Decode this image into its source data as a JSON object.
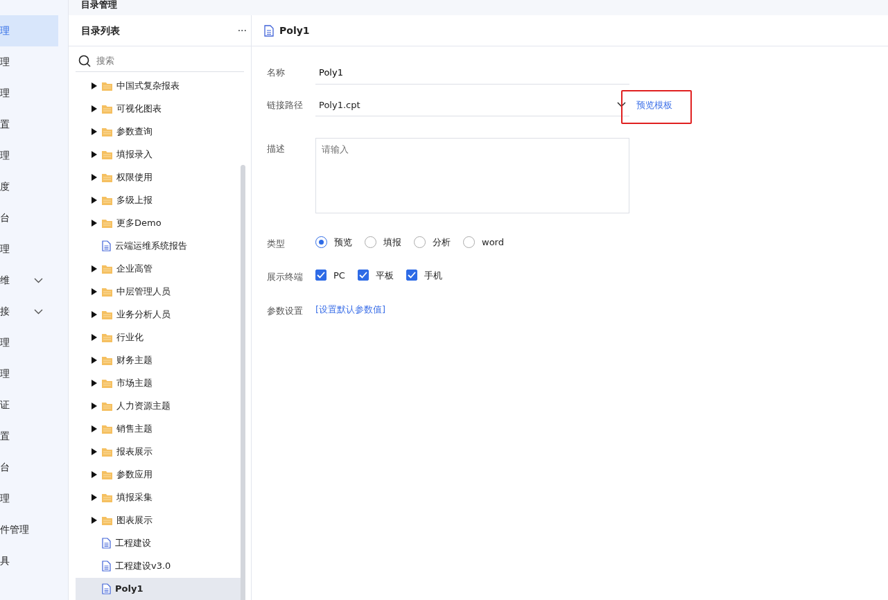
{
  "page_title": "目录管理",
  "sidebar": {
    "items": [
      {
        "label": "理",
        "selected": true
      },
      {
        "label": "理",
        "selected": false
      },
      {
        "label": "理",
        "selected": false
      },
      {
        "label": "置",
        "selected": false
      },
      {
        "label": "理",
        "selected": false
      },
      {
        "label": "度",
        "selected": false
      },
      {
        "label": "台",
        "selected": false
      },
      {
        "label": "理",
        "selected": false
      },
      {
        "label": "维",
        "selected": false,
        "expandable": true
      },
      {
        "label": "接",
        "selected": false,
        "expandable": true
      },
      {
        "label": "理",
        "selected": false
      },
      {
        "label": "理",
        "selected": false
      },
      {
        "label": "证",
        "selected": false
      },
      {
        "label": "置",
        "selected": false
      },
      {
        "label": "台",
        "selected": false
      },
      {
        "label": "理",
        "selected": false
      },
      {
        "label": "件管理",
        "selected": false
      },
      {
        "label": "具",
        "selected": false
      }
    ]
  },
  "tree": {
    "title": "目录列表",
    "more": "···",
    "search": {
      "placeholder": "搜索"
    },
    "items": [
      {
        "kind": "folder",
        "label": "中国式复杂报表",
        "expanded": false,
        "selected": false
      },
      {
        "kind": "folder",
        "label": "可视化图表",
        "expanded": false,
        "selected": false
      },
      {
        "kind": "folder",
        "label": "参数查询",
        "expanded": false,
        "selected": false
      },
      {
        "kind": "folder",
        "label": "填报录入",
        "expanded": false,
        "selected": false
      },
      {
        "kind": "folder",
        "label": "权限使用",
        "expanded": false,
        "selected": false
      },
      {
        "kind": "folder",
        "label": "多级上报",
        "expanded": false,
        "selected": false
      },
      {
        "kind": "folder",
        "label": "更多Demo",
        "expanded": false,
        "selected": false
      },
      {
        "kind": "file",
        "label": "云端运维系统报告",
        "selected": false
      },
      {
        "kind": "folder",
        "label": "企业高管",
        "expanded": false,
        "selected": false
      },
      {
        "kind": "folder",
        "label": "中层管理人员",
        "expanded": false,
        "selected": false
      },
      {
        "kind": "folder",
        "label": "业务分析人员",
        "expanded": false,
        "selected": false
      },
      {
        "kind": "folder",
        "label": "行业化",
        "expanded": false,
        "selected": false
      },
      {
        "kind": "folder",
        "label": "财务主题",
        "expanded": false,
        "selected": false
      },
      {
        "kind": "folder",
        "label": "市场主题",
        "expanded": false,
        "selected": false
      },
      {
        "kind": "folder",
        "label": "人力资源主题",
        "expanded": false,
        "selected": false
      },
      {
        "kind": "folder",
        "label": "销售主题",
        "expanded": false,
        "selected": false
      },
      {
        "kind": "folder",
        "label": "报表展示",
        "expanded": false,
        "selected": false
      },
      {
        "kind": "folder",
        "label": "参数应用",
        "expanded": false,
        "selected": false
      },
      {
        "kind": "folder",
        "label": "填报采集",
        "expanded": false,
        "selected": false
      },
      {
        "kind": "folder",
        "label": "图表展示",
        "expanded": false,
        "selected": false
      },
      {
        "kind": "file",
        "label": "工程建设",
        "selected": false
      },
      {
        "kind": "file",
        "label": "工程建设v3.0",
        "selected": false
      },
      {
        "kind": "file",
        "label": "Poly1",
        "selected": true
      }
    ]
  },
  "detail": {
    "title": "Poly1",
    "name": {
      "label": "名称",
      "value": "Poly1"
    },
    "path": {
      "label": "链接路径",
      "value": "Poly1.cpt",
      "preview_link": "预览模板"
    },
    "description": {
      "label": "描述",
      "placeholder": "请输入"
    },
    "type": {
      "label": "类型",
      "options": [
        {
          "label": "预览",
          "selected": true
        },
        {
          "label": "填报",
          "selected": false
        },
        {
          "label": "分析",
          "selected": false
        },
        {
          "label": "word",
          "selected": false
        }
      ]
    },
    "terminals": {
      "label": "展示终端",
      "options": [
        {
          "label": "PC",
          "checked": true
        },
        {
          "label": "平板",
          "checked": true
        },
        {
          "label": "手机",
          "checked": true
        }
      ]
    },
    "params": {
      "label": "参数设置",
      "link": "[设置默认参数值]"
    }
  }
}
